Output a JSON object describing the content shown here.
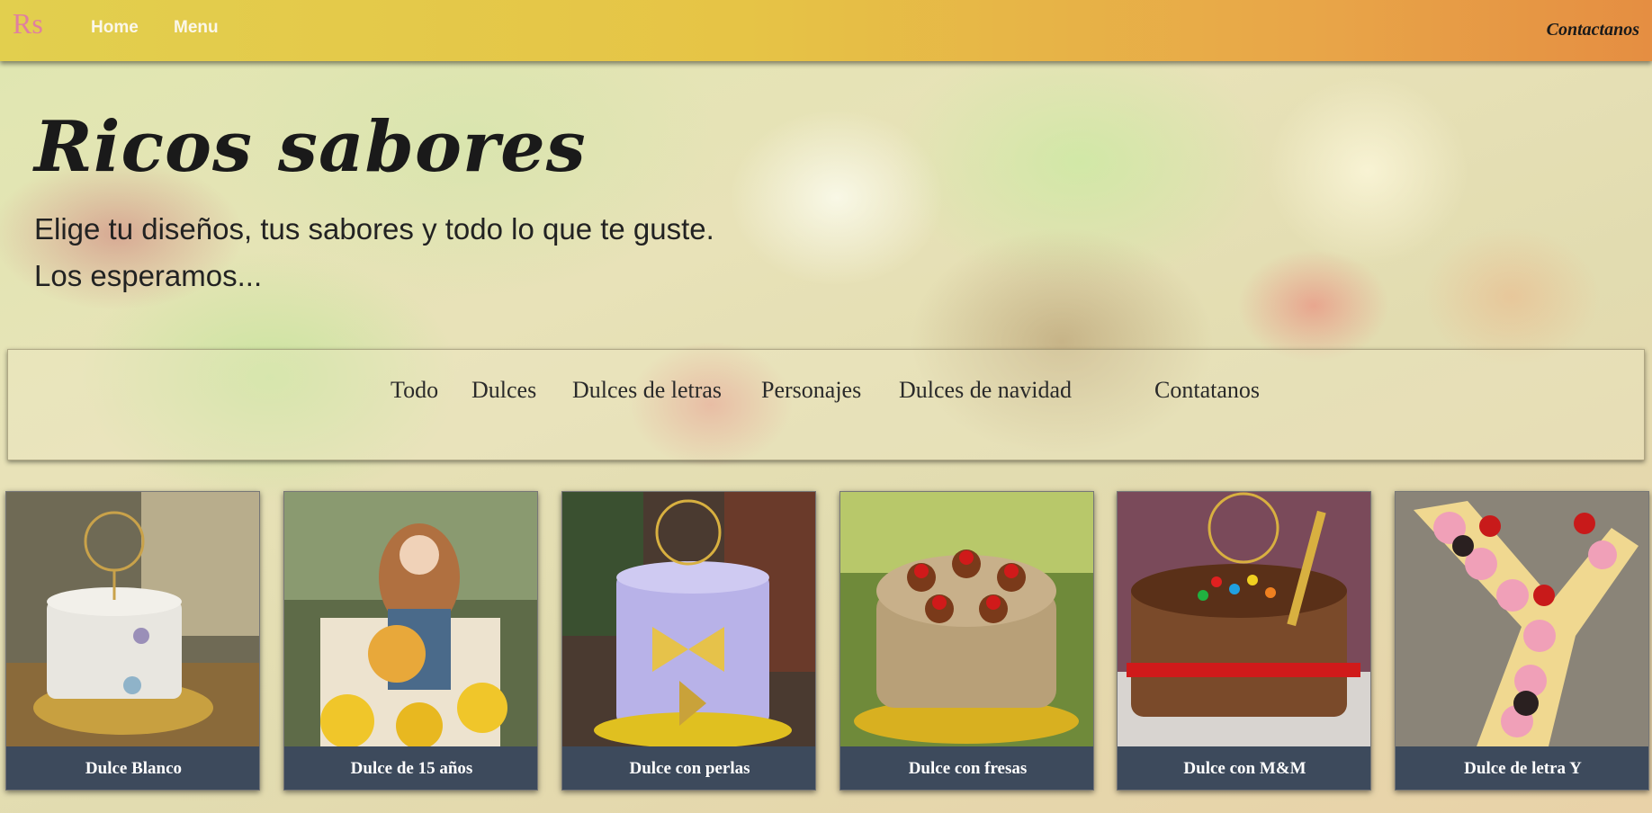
{
  "navbar": {
    "logo": "Rs",
    "links": [
      "Home",
      "Menu"
    ],
    "contact": "Contactanos"
  },
  "hero": {
    "title": "Ricos sabores",
    "line1": "Elige tu diseños, tus sabores y todo lo que te guste.",
    "line2": "Los esperamos..."
  },
  "filters": [
    "Todo",
    "Dulces",
    "Dulces de letras",
    "Personajes",
    "Dulces de navidad",
    "Contatanos"
  ],
  "cards": [
    {
      "title": "Dulce Blanco",
      "icon": "white-cake-photo"
    },
    {
      "title": "Dulce de 15 años",
      "icon": "quinceanera-cake-photo"
    },
    {
      "title": "Dulce con perlas",
      "icon": "pearl-butterfly-cake-photo"
    },
    {
      "title": "Dulce con fresas",
      "icon": "strawberry-cake-photo"
    },
    {
      "title": "Dulce con M&M",
      "icon": "mm-chocolate-cake-photo"
    },
    {
      "title": "Dulce de letra Y",
      "icon": "letter-y-cake-photo"
    }
  ],
  "colors": {
    "navbar_start": "#e2cf4e",
    "navbar_end": "#e58e42",
    "logo": "#e07fa0",
    "card_caption_bg": "#3d4a5c"
  }
}
